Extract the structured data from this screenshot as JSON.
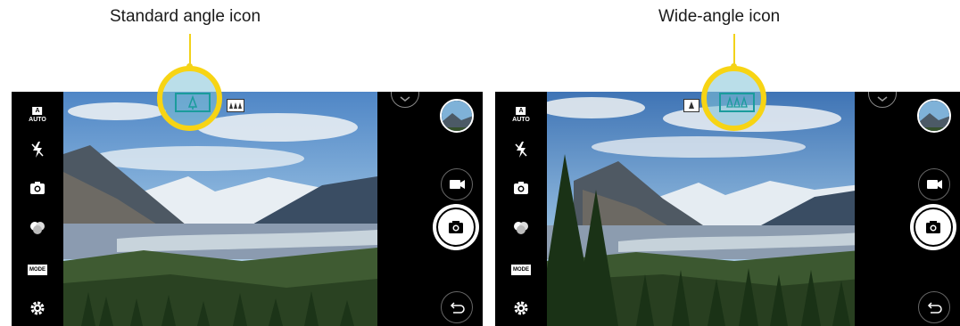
{
  "captions": {
    "standard": "Standard angle icon",
    "wide": "Wide-angle icon"
  },
  "screens": [
    {
      "view": "standard",
      "side_bar": {
        "mode_badge": "A",
        "mode_label": "AUTO",
        "menu_box": "MODE"
      }
    },
    {
      "view": "wide",
      "side_bar": {
        "mode_badge": "A",
        "mode_label": "AUTO",
        "menu_box": "MODE"
      }
    }
  ],
  "icons": {
    "auto": "auto-mode-icon",
    "flash": "flash-off-icon",
    "switch_camera": "switch-camera-icon",
    "filter": "filter-icon",
    "mode": "mode-icon",
    "settings": "gear-icon",
    "expand": "chevron-down-icon",
    "gallery": "gallery-thumbnail",
    "video": "video-camera-icon",
    "shutter": "camera-shutter-icon",
    "back": "back-icon"
  },
  "colors": {
    "highlight": "#f7d414",
    "angle_icon": "#1a9c9c",
    "bar": "#000000"
  }
}
